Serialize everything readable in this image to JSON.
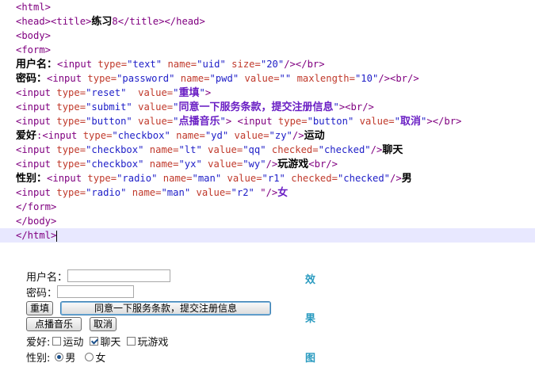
{
  "code_lines": [
    {
      "tag1": "<html>"
    },
    {
      "tag1": "<head><title>",
      "cn": "练习",
      "tag2": "8</title></head>"
    },
    {
      "tag1": "<body>"
    },
    {
      "tag1": "<form>"
    },
    {
      "cn": "用户名：",
      "tag1": "<input ",
      "a1": "type=",
      "s1": "\"text\"",
      "a2": " name=",
      "s2": "\"uid\"",
      "a3": " size=",
      "s3": "\"20\"",
      "tag2": "/></br>"
    },
    {
      "cn": "密码：",
      "tag1": "<input ",
      "a1": "type=",
      "s1": "\"password\"",
      "a2": " name=",
      "s2": "\"pwd\"",
      "a3": " value=",
      "s3": "\"\"",
      "a4": " maxlength=",
      "s4": "\"10\"",
      "tag2": "/><br/>"
    },
    {
      "tag1": "<input ",
      "a1": "type=",
      "s1": "\"reset\"",
      "a2": "  value=",
      "s2q": "\"",
      "cnv": "重填",
      "s2e": "\"",
      "tag2": ">"
    },
    {
      "tag1": "<input ",
      "a1": "type=",
      "s1": "\"submit\"",
      "a2": " value=",
      "s2q": "\"",
      "cnv": "同意一下服务条款，提交注册信息",
      "s2e": "\"",
      "tag2": "><br/>"
    },
    {
      "tag1": "<input ",
      "a1": "type=",
      "s1": "\"button\"",
      "a2": " value=",
      "s2q": "\"",
      "cnv": "点播音乐",
      "s2e": "\"",
      "tag2": "> <input ",
      "a3": "type=",
      "s3": "\"button\"",
      "a4": " value=",
      "s4q": "\"",
      "cnv2": "取消",
      "s4e": "\"",
      "tag3": "></br>"
    },
    {
      "cn": "爱好",
      "tag0": ":<input ",
      "a1": "type=",
      "s1": "\"checkbox\"",
      "a2": " name=",
      "s2": "\"yd\"",
      "a3": " value=",
      "s3": "\"zy\"",
      "tag2": "/>",
      "cn2": "运动"
    },
    {
      "tag1": "<input ",
      "a1": "type=",
      "s1": "\"checkbox\"",
      "a2": " name=",
      "s2": "\"lt\"",
      "a3": " value=",
      "s3": "\"qq\"",
      "a4": " checked=",
      "s4": "\"checked\"",
      "tag2": "/>",
      "cn2": "聊天"
    },
    {
      "tag1": "<input ",
      "a1": "type=",
      "s1": "\"checkbox\"",
      "a2": " name=",
      "s2": "\"yx\"",
      "a3": " value=",
      "s3": "\"wy\"",
      "tag2": "/>",
      "cn2": "玩游戏",
      "tag3": "<br/>"
    },
    {
      "cn": "性别：",
      "tag1": "<input ",
      "a1": "type=",
      "s1": "\"radio\"",
      "a2": " name=",
      "s2": "\"man\"",
      "a3": " value=",
      "s3": "\"r1\"",
      "a4": " checked=",
      "s4": "\"checked\"",
      "tag2": "/>",
      "cn2": "男"
    },
    {
      "tag1": "<input ",
      "a1": "type=",
      "s1": "\"radio\"",
      "a2": " name=",
      "s2": "\"man\"",
      "a3": " value=",
      "s3": "\"r2\"",
      "tag2": " \"/>",
      "cnv": "女"
    },
    {
      "tag1": "</form>"
    },
    {
      "tag1": "</body>"
    },
    {
      "tag1": "</html>"
    }
  ],
  "preview": {
    "username_label": "用户名：",
    "username_value": "",
    "password_label": "密码：",
    "password_value": "",
    "reset_label": "重填",
    "submit_label": "同意一下服务条款，提交注册信息",
    "play_label": "点播音乐",
    "cancel_label": "取消",
    "hobby_label": "爱好:",
    "hobby_1": "运动",
    "hobby_2": "聊天",
    "hobby_3": "玩游戏",
    "gender_label": "性别:",
    "gender_male": "男",
    "gender_female": "女",
    "hobby_1_checked": false,
    "hobby_2_checked": true,
    "hobby_3_checked": false,
    "gender_selected": "男"
  },
  "side_labels": [
    "效",
    "果",
    "图"
  ],
  "colors": {
    "tag": "#800080",
    "attr": "#c0392b",
    "string": "#2020c8",
    "value_cn": "#6a1fc4",
    "side": "#2a9bc0",
    "highlight": "#e8e8ff"
  }
}
